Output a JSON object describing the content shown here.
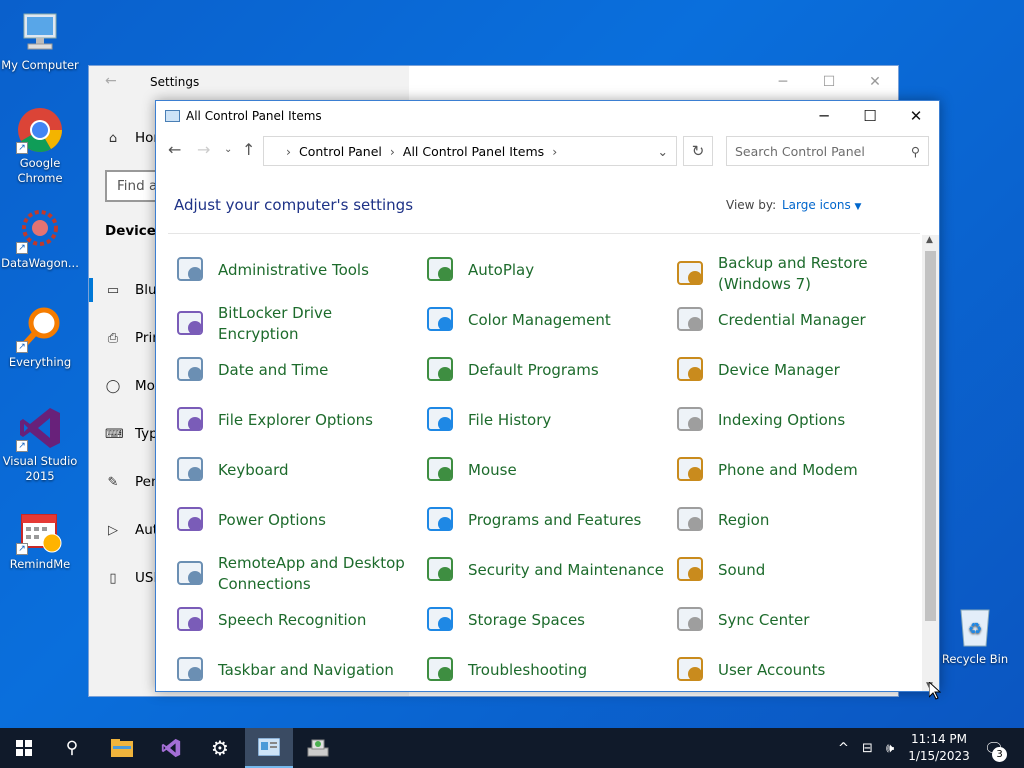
{
  "desktop": {
    "icons": [
      {
        "label": "My Computer"
      },
      {
        "label": "Google Chrome"
      },
      {
        "label": "DataWagon..."
      },
      {
        "label": "Everything"
      },
      {
        "label": "Visual Studio 2015"
      },
      {
        "label": "RemindMe"
      },
      {
        "label": "Recycle Bin"
      }
    ]
  },
  "settings": {
    "title": "Settings",
    "items": [
      "Hom",
      "Find a",
      "Devices",
      "Blue",
      "Prin",
      "Mo",
      "Typ",
      "Pen",
      "Aut",
      "USE"
    ]
  },
  "control_panel": {
    "title": "All Control Panel Items",
    "breadcrumb": [
      "Control Panel",
      "All Control Panel Items"
    ],
    "search_placeholder": "Search Control Panel",
    "heading": "Adjust your computer's settings",
    "view_by_label": "View by:",
    "view_by_value": "Large icons",
    "items": [
      {
        "label": "Administrative Tools",
        "icon": "admin-tools-icon"
      },
      {
        "label": "AutoPlay",
        "icon": "autoplay-icon"
      },
      {
        "label": "Backup and Restore (Windows 7)",
        "icon": "backup-icon"
      },
      {
        "label": "BitLocker Drive Encryption",
        "icon": "bitlocker-icon"
      },
      {
        "label": "Color Management",
        "icon": "color-management-icon"
      },
      {
        "label": "Credential Manager",
        "icon": "credential-icon"
      },
      {
        "label": "Date and Time",
        "icon": "calendar-clock-icon"
      },
      {
        "label": "Default Programs",
        "icon": "default-programs-icon"
      },
      {
        "label": "Device Manager",
        "icon": "device-manager-icon"
      },
      {
        "label": "File Explorer Options",
        "icon": "folder-options-icon"
      },
      {
        "label": "File History",
        "icon": "file-history-icon"
      },
      {
        "label": "Indexing Options",
        "icon": "indexing-icon"
      },
      {
        "label": "Keyboard",
        "icon": "keyboard-icon"
      },
      {
        "label": "Mouse",
        "icon": "mouse-icon"
      },
      {
        "label": "Phone and Modem",
        "icon": "phone-icon"
      },
      {
        "label": "Power Options",
        "icon": "power-icon"
      },
      {
        "label": "Programs and Features",
        "icon": "programs-icon"
      },
      {
        "label": "Region",
        "icon": "globe-icon"
      },
      {
        "label": "RemoteApp and Desktop Connections",
        "icon": "remoteapp-icon"
      },
      {
        "label": "Security and Maintenance",
        "icon": "flag-icon"
      },
      {
        "label": "Sound",
        "icon": "speaker-icon"
      },
      {
        "label": "Speech Recognition",
        "icon": "microphone-icon"
      },
      {
        "label": "Storage Spaces",
        "icon": "storage-icon"
      },
      {
        "label": "Sync Center",
        "icon": "sync-icon"
      },
      {
        "label": "Taskbar and Navigation",
        "icon": "taskbar-icon"
      },
      {
        "label": "Troubleshooting",
        "icon": "troubleshooting-icon"
      },
      {
        "label": "User Accounts",
        "icon": "users-icon"
      }
    ]
  },
  "taskbar": {
    "clock_time": "11:14 PM",
    "clock_date": "1/15/2023",
    "notification_count": "3"
  }
}
